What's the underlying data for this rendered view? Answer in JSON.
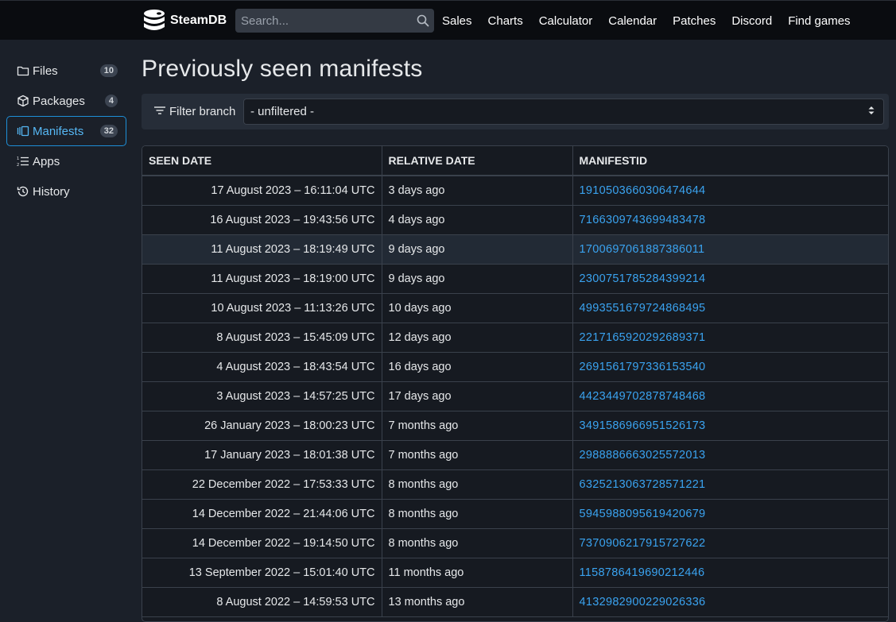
{
  "nav": {
    "logo_text": "SteamDB",
    "search_placeholder": "Search...",
    "links": [
      "Sales",
      "Charts",
      "Calculator",
      "Calendar",
      "Patches",
      "Discord",
      "Find games"
    ]
  },
  "sidebar": {
    "items": [
      {
        "label": "Files",
        "count": "10",
        "icon": "folder-icon",
        "active": false
      },
      {
        "label": "Packages",
        "count": "4",
        "icon": "package-icon",
        "active": false
      },
      {
        "label": "Manifests",
        "count": "32",
        "icon": "manifest-icon",
        "active": true
      },
      {
        "label": "Apps",
        "count": "",
        "icon": "list-icon",
        "active": false
      },
      {
        "label": "History",
        "count": "",
        "icon": "history-icon",
        "active": false
      }
    ]
  },
  "main": {
    "title": "Previously seen manifests",
    "filter": {
      "label": "Filter branch",
      "selected": "- unfiltered -"
    },
    "table": {
      "headers": [
        "SEEN DATE",
        "RELATIVE DATE",
        "MANIFESTID"
      ],
      "rows": [
        {
          "seen": "17 August 2023 – 16:11:04 UTC",
          "relative": "3 days ago",
          "id": "1910503660306474644"
        },
        {
          "seen": "16 August 2023 – 19:43:56 UTC",
          "relative": "4 days ago",
          "id": "7166309743699483478"
        },
        {
          "seen": "11 August 2023 – 18:19:49 UTC",
          "relative": "9 days ago",
          "id": "1700697061887386011"
        },
        {
          "seen": "11 August 2023 – 18:19:00 UTC",
          "relative": "9 days ago",
          "id": "2300751785284399214"
        },
        {
          "seen": "10 August 2023 – 11:13:26 UTC",
          "relative": "10 days ago",
          "id": "4993551679724868495"
        },
        {
          "seen": "8 August 2023 – 15:45:09 UTC",
          "relative": "12 days ago",
          "id": "2217165920292689371"
        },
        {
          "seen": "4 August 2023 – 18:43:54 UTC",
          "relative": "16 days ago",
          "id": "2691561797336153540"
        },
        {
          "seen": "3 August 2023 – 14:57:25 UTC",
          "relative": "17 days ago",
          "id": "4423449702878748468"
        },
        {
          "seen": "26 January 2023 – 18:00:23 UTC",
          "relative": "7 months ago",
          "id": "3491586966951526173"
        },
        {
          "seen": "17 January 2023 – 18:01:38 UTC",
          "relative": "7 months ago",
          "id": "2988886663025572013"
        },
        {
          "seen": "22 December 2022 – 17:53:33 UTC",
          "relative": "8 months ago",
          "id": "6325213063728571221"
        },
        {
          "seen": "14 December 2022 – 21:44:06 UTC",
          "relative": "8 months ago",
          "id": "5945988095619420679"
        },
        {
          "seen": "14 December 2022 – 19:14:50 UTC",
          "relative": "8 months ago",
          "id": "7370906217915727622"
        },
        {
          "seen": "13 September 2022 – 15:01:40 UTC",
          "relative": "11 months ago",
          "id": "1158786419690212446"
        },
        {
          "seen": "8 August 2022 – 14:59:53 UTC",
          "relative": "13 months ago",
          "id": "4132982900229026336"
        }
      ],
      "highlighted_row": 2
    }
  },
  "colors": {
    "link": "#3aa3f0",
    "active_border": "#1e8fd8",
    "background": "#1b2029",
    "navbar": "#0a0c10"
  }
}
